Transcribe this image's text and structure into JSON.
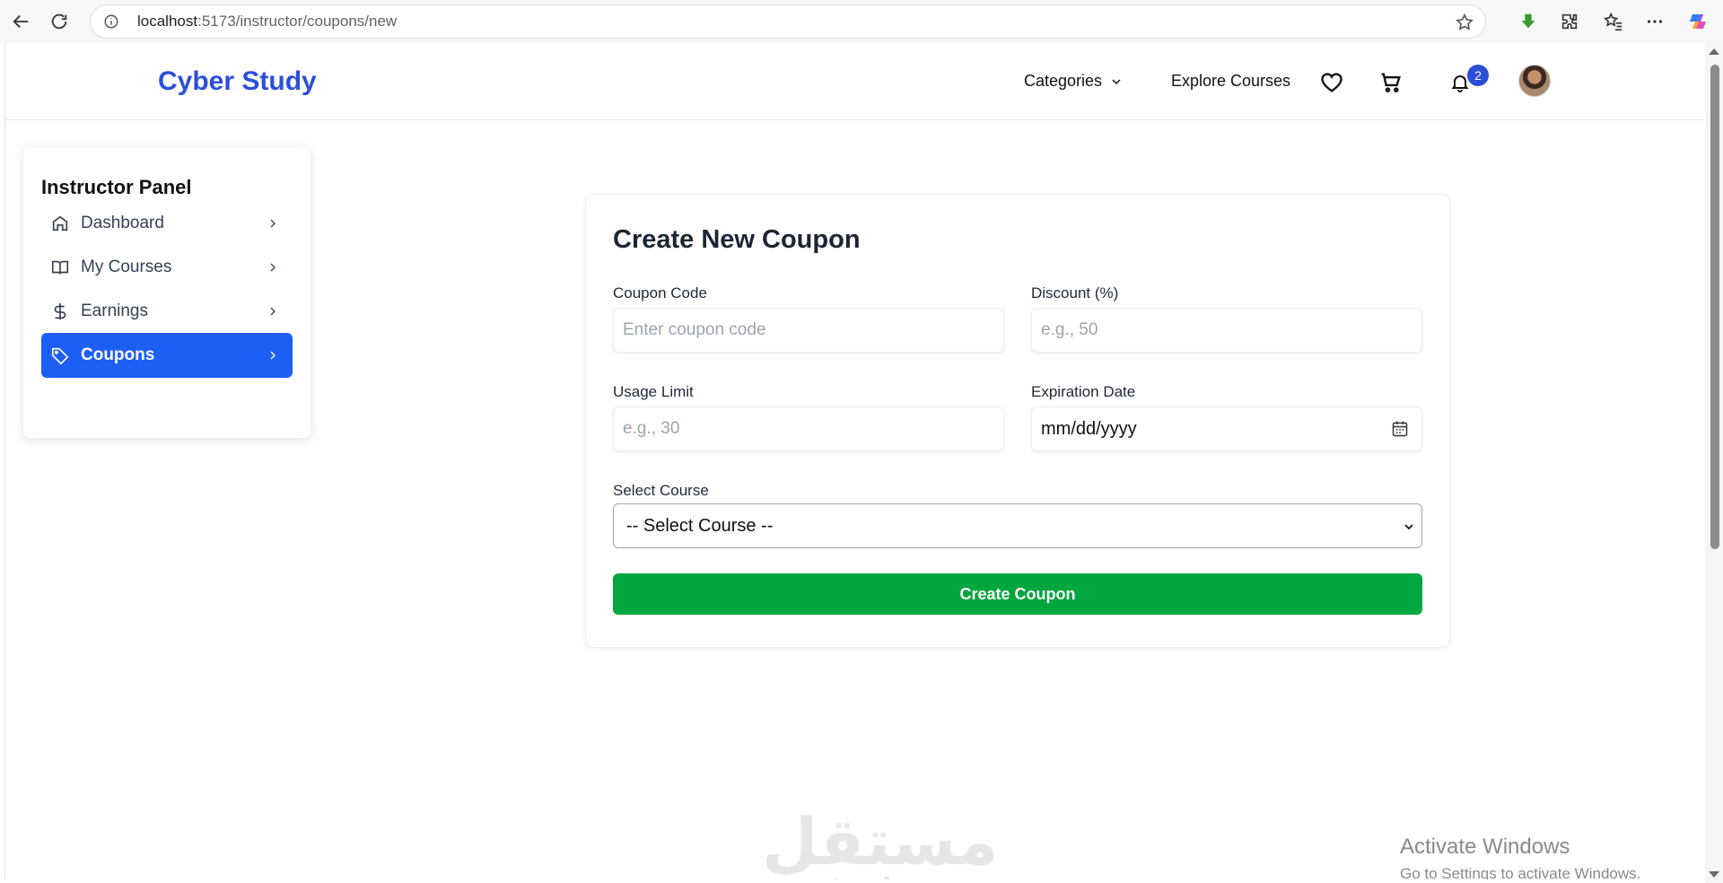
{
  "browser": {
    "url_host": "localhost",
    "url_path": ":5173/instructor/coupons/new"
  },
  "header": {
    "logo": "Cyber Study",
    "categories_label": "Categories",
    "explore_label": "Explore Courses",
    "notification_count": "2"
  },
  "sidebar": {
    "title": "Instructor Panel",
    "items": [
      {
        "label": "Dashboard",
        "icon": "home-icon"
      },
      {
        "label": "My Courses",
        "icon": "book-icon"
      },
      {
        "label": "Earnings",
        "icon": "dollar-icon"
      },
      {
        "label": "Coupons",
        "icon": "tag-icon",
        "active": true
      }
    ]
  },
  "form": {
    "title": "Create New Coupon",
    "coupon_code_label": "Coupon Code",
    "coupon_code_placeholder": "Enter coupon code",
    "discount_label": "Discount (%)",
    "discount_placeholder": "e.g., 50",
    "usage_limit_label": "Usage Limit",
    "usage_limit_placeholder": "e.g., 30",
    "expiration_label": "Expiration Date",
    "expiration_value": "mm/dd/yyyy",
    "course_label": "Select Course",
    "course_selected": "-- Select Course --",
    "submit_label": "Create Coupon"
  },
  "watermark": {
    "arabic": "مستقل",
    "latin": "mostaql.com"
  },
  "os_notice": {
    "title": "Activate Windows",
    "subtitle": "Go to Settings to activate Windows."
  },
  "colors": {
    "brand": "#2b4fd8",
    "active_nav": "#1d5ef5",
    "submit": "#00a63e"
  }
}
